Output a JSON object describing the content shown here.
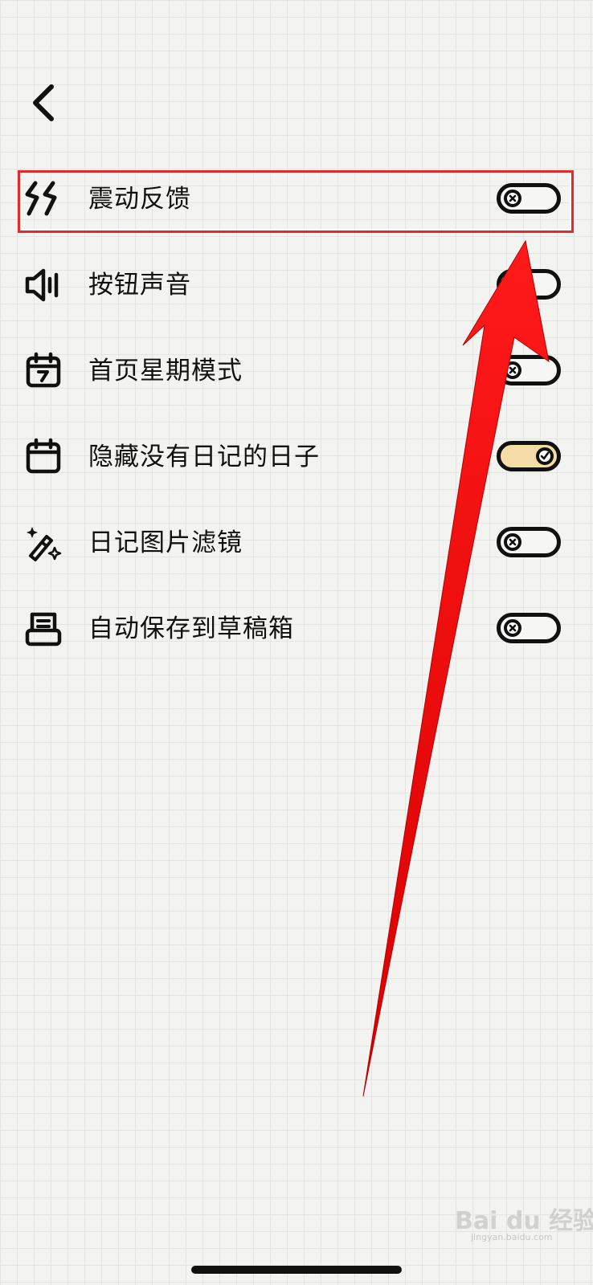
{
  "header": {
    "back_icon": "chevron-left-icon"
  },
  "settings": [
    {
      "icon": "vibration-icon",
      "label": "震动反馈",
      "enabled": false
    },
    {
      "icon": "speaker-icon",
      "label": "按钮声音",
      "enabled": false
    },
    {
      "icon": "calendar-week-icon",
      "label": "首页星期模式",
      "enabled": false
    },
    {
      "icon": "calendar-icon",
      "label": "隐藏没有日记的日子",
      "enabled": true
    },
    {
      "icon": "magic-wand-icon",
      "label": "日记图片滤镜",
      "enabled": false
    },
    {
      "icon": "drafts-tray-icon",
      "label": "自动保存到草稿箱",
      "enabled": false
    }
  ],
  "annotation": {
    "highlighted_row": 0,
    "color": "#e32a2a"
  },
  "watermark": {
    "text": "Bai du 经验",
    "sub": "jingyan.baidu.com"
  },
  "colors": {
    "toggle_on": "#f5dca7",
    "outline": "#111111",
    "background": "#f3f3f1"
  }
}
